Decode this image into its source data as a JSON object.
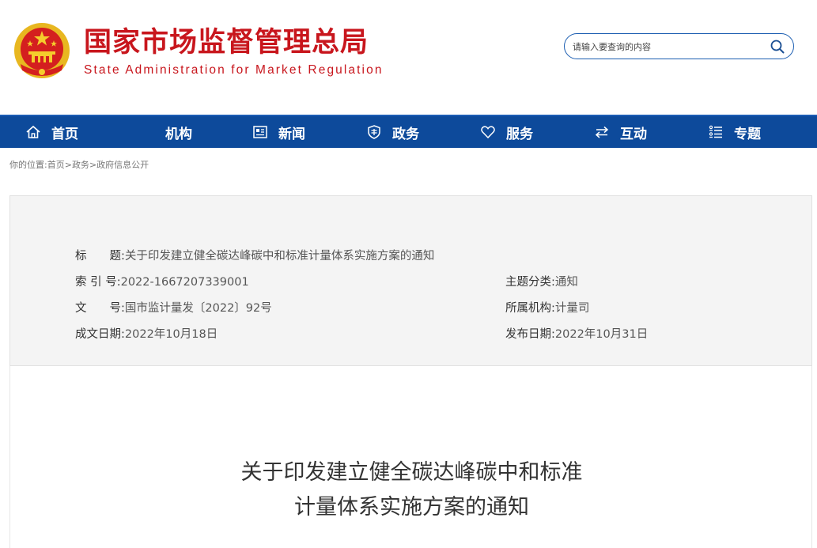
{
  "header": {
    "brand_cn": "国家市场监督管理总局",
    "brand_en": "State Administration for Market Regulation",
    "emblem_icon": "national-emblem-icon",
    "search_placeholder": "请输入要查询的内容",
    "search_icon": "search-icon",
    "brand_color": "#c8161d"
  },
  "nav": {
    "background": "#0d4a9b",
    "items": [
      {
        "label": "首页",
        "icon": "home-icon"
      },
      {
        "label": "机构",
        "icon": ""
      },
      {
        "label": "新闻",
        "icon": "news-icon"
      },
      {
        "label": "政务",
        "icon": "shield-icon"
      },
      {
        "label": "服务",
        "icon": "heart-icon"
      },
      {
        "label": "互动",
        "icon": "exchange-icon"
      },
      {
        "label": "专题",
        "icon": "list-icon"
      }
    ]
  },
  "breadcrumb": {
    "prefix": "你的位置:",
    "items": [
      "首页",
      "政务",
      "政府信息公开"
    ],
    "separator": ">"
  },
  "info": {
    "title_key": "标　　题:",
    "title_value": "关于印发建立健全碳达峰碳中和标准计量体系实施方案的通知",
    "index_key": "索 引 号:",
    "index_value": "2022-1667207339001",
    "doc_key": "文　　号:",
    "doc_value": "国市监计量发〔2022〕92号",
    "date_key": "成文日期:",
    "date_value": "2022年10月18日",
    "topic_key": "主题分类:",
    "topic_value": "通知",
    "org_key": "所属机构:",
    "org_value": "计量司",
    "pub_key": "发布日期:",
    "pub_value": "2022年10月31日"
  },
  "article": {
    "title_line1": "关于印发建立健全碳达峰碳中和标准",
    "title_line2": "计量体系实施方案的通知"
  }
}
